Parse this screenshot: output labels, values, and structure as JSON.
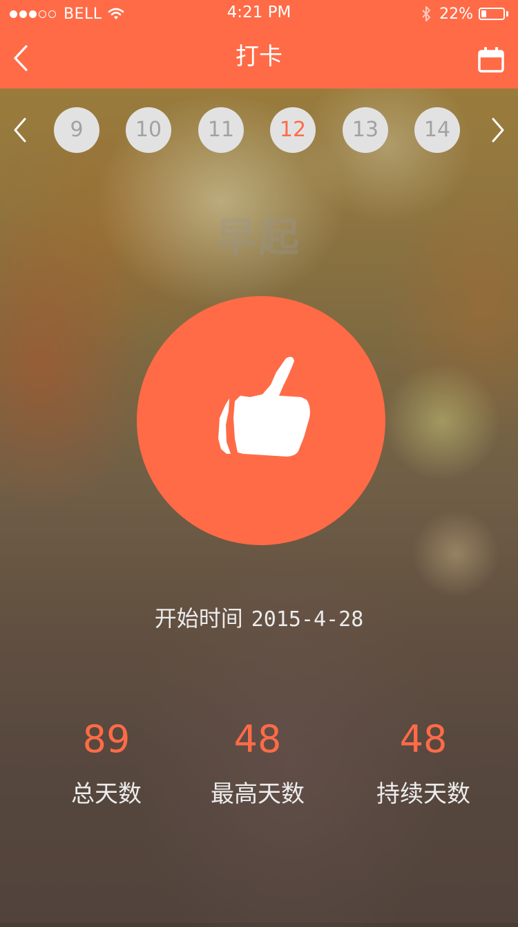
{
  "status_bar": {
    "carrier": "BELL",
    "time": "4:21 PM",
    "battery_percent": "22%",
    "battery_level": 0.22,
    "signal_bars_filled": 3,
    "signal_bars_total": 5,
    "icons": [
      "signal-dots-icon",
      "wifi-icon",
      "bluetooth-icon",
      "battery-icon"
    ]
  },
  "nav": {
    "title": "打卡",
    "back_icon": "chevron-left-icon",
    "calendar_icon": "calendar-icon"
  },
  "day_selector": {
    "days": [
      "9",
      "10",
      "11",
      "12",
      "13",
      "14"
    ],
    "selected": "12",
    "prev_icon": "chevron-left-icon",
    "next_icon": "chevron-right-icon"
  },
  "habit": {
    "name": "早起",
    "checkin_icon": "thumbs-up-icon"
  },
  "start": {
    "label": "开始时间",
    "date": "2015-4-28"
  },
  "stats": [
    {
      "value": "89",
      "label": "总天数"
    },
    {
      "value": "48",
      "label": "最高天数"
    },
    {
      "value": "48",
      "label": "持续天数"
    }
  ],
  "colors": {
    "accent": "#ff6b47",
    "day_bubble": "#e2e2e2",
    "day_text": "#a2a2a2",
    "light_text": "#ececec"
  }
}
